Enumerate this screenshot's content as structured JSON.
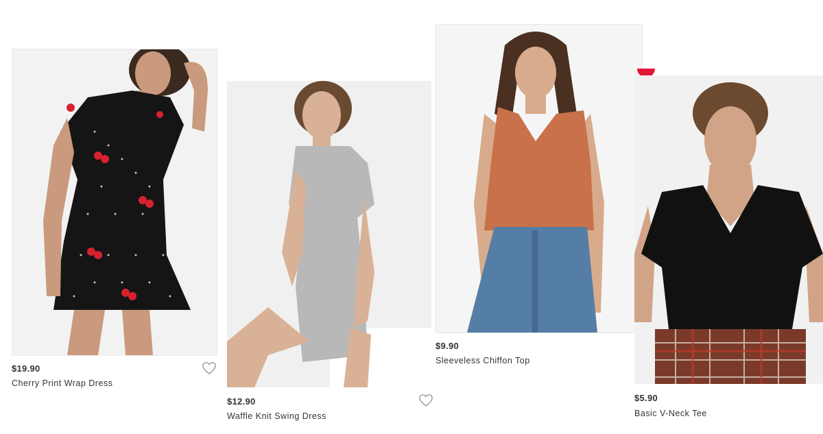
{
  "products": [
    {
      "price": "$19.90",
      "name": "Cherry Print Wrap Dress",
      "image": "woman in black polka dot dress with cherry print",
      "favorite": "heart-outline-icon"
    },
    {
      "price": "$12.90",
      "name": "Waffle Knit Swing Dress",
      "image": "woman in grey short sleeve dress seated",
      "favorite": "heart-outline-icon"
    },
    {
      "price": "$9.90",
      "name": "Sleeveless Chiffon Top",
      "image": "woman in rust sleeveless top and blue jeans"
    },
    {
      "price": "$5.90",
      "name": "Basic V-Neck Tee",
      "image": "woman in black v-neck tee and plaid skirt"
    }
  ],
  "colors": {
    "text": "#333333",
    "heart": "#9a9a9a",
    "badge": "#e31837"
  }
}
